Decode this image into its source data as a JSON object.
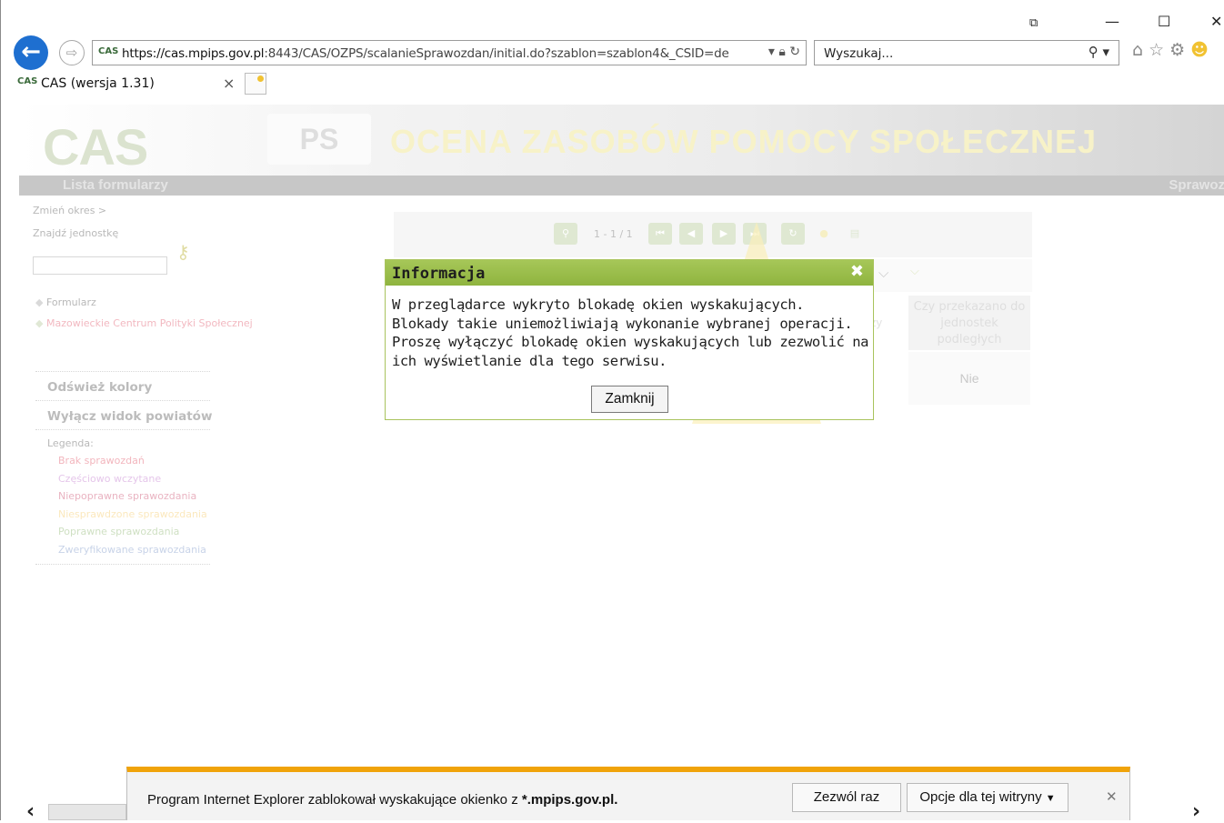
{
  "browser": {
    "url_prefix": "https://cas.",
    "url_host": "mpips.gov.pl",
    "url_rest": ":8443/CAS/OZPS/scalanieSprawozdan/initial.do?szablon=szablon4&_CSID=de",
    "site_icon": "CAS",
    "search_placeholder": "Wyszukaj...",
    "tab_title": "CAS (wersja 1.31)",
    "tab_icon": "CAS",
    "icons": [
      "back-icon",
      "forward-icon",
      "lock-icon",
      "refresh-icon",
      "search-icon",
      "home-icon",
      "star-icon",
      "gear-icon",
      "smiley-icon"
    ]
  },
  "header": {
    "logo": "CAS",
    "module": "PS",
    "title": "OCENA ZASOBÓW POMOCY SPOŁECZNEJ",
    "nav_left": "Lista formularzy",
    "nav_right": "Sprawoz"
  },
  "sidebar": {
    "change_period": "Zmień okres  >",
    "find_unit": "Znajdź jednostkę",
    "tree": [
      {
        "label": "Formularz",
        "color": "#bdbdbd"
      },
      {
        "label": "Mazowieckie Centrum Polityki Społecznej",
        "color": "#f2b8c0"
      }
    ],
    "refresh_colors": "Odśwież kolory",
    "disable_county": "Wyłącz widok powiatów",
    "legend_label": "Legenda:",
    "legend": [
      {
        "label": "Brak sprawozdań",
        "color": "#f2b5bd"
      },
      {
        "label": "Częściowo wczytane",
        "color": "#e5c6ea"
      },
      {
        "label": "Niepoprawne sprawozdania",
        "color": "#e9b3c1"
      },
      {
        "label": "Niesprawdzone sprawozdania",
        "color": "#fbe8bd"
      },
      {
        "label": "Poprawne sprawozdania",
        "color": "#cfe0c3"
      },
      {
        "label": "Zweryfikowane sprawozdania",
        "color": "#c8d3e8"
      }
    ]
  },
  "grid": {
    "page_info": "1 - 1 / 1",
    "column_header": "Czy przekazano do jednostek podległych",
    "column_partial": "zy",
    "cell_value": "Nie"
  },
  "dialog": {
    "title": "Informacja",
    "close_icon": "✖",
    "lines": [
      "W przeglądarce wykryto blokadę okien wyskakujących.",
      "Blokady takie uniemożliwiają wykonanie wybranej operacji.",
      "Proszę wyłączyć blokadę okien wyskakujących lub zezwolić na",
      "ich wyświetlanie dla tego serwisu."
    ],
    "button": "Zamknij"
  },
  "notification": {
    "message_prefix": "Program Internet Explorer zablokował wyskakujące okienko z ",
    "message_host": "*.mpips.gov.pl.",
    "allow_once": "Zezwól raz",
    "site_options": "Opcje dla tej witryny",
    "accent": "#f0a30a"
  }
}
